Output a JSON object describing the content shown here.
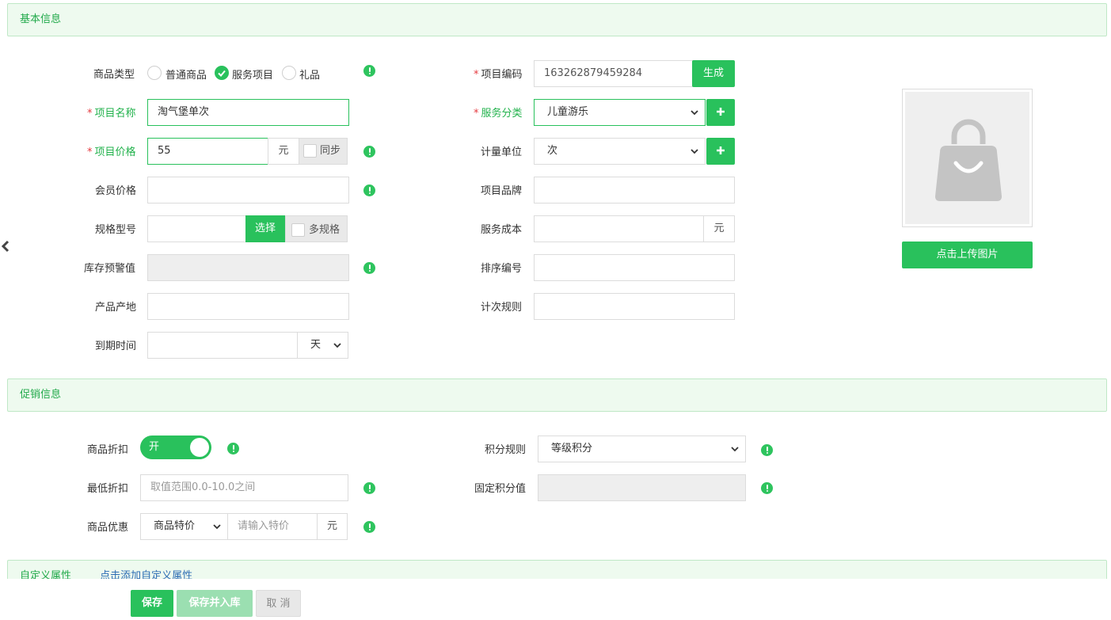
{
  "sections": {
    "basic": "基本信息",
    "promo": "促销信息",
    "custom": "自定义属性",
    "custom_add": "点击添加自定义属性"
  },
  "basic": {
    "product_type": {
      "label": "商品类型",
      "options": [
        "普通商品",
        "服务项目",
        "礼品"
      ],
      "selected": "服务项目"
    },
    "item_name": {
      "label": "项目名称",
      "value": "淘气堡单次"
    },
    "item_price": {
      "label": "项目价格",
      "value": "55",
      "unit": "元",
      "sync": "同步"
    },
    "member_price": {
      "label": "会员价格",
      "value": ""
    },
    "spec": {
      "label": "规格型号",
      "value": "",
      "choose": "选择",
      "multi": "多规格"
    },
    "stock_alert": {
      "label": "库存预警值",
      "value": ""
    },
    "origin": {
      "label": "产品产地",
      "value": ""
    },
    "expire": {
      "label": "到期时间",
      "value": "",
      "unit": "天"
    },
    "item_code": {
      "label": "项目编码",
      "value": "163262879459284",
      "generate": "生成"
    },
    "service_category": {
      "label": "服务分类",
      "value": "儿童游乐"
    },
    "measure_unit": {
      "label": "计量单位",
      "value": "次"
    },
    "brand": {
      "label": "项目品牌",
      "value": ""
    },
    "service_cost": {
      "label": "服务成本",
      "value": "",
      "unit": "元"
    },
    "sort_no": {
      "label": "排序编号",
      "value": ""
    },
    "count_rule": {
      "label": "计次规则",
      "value": ""
    },
    "upload": "点击上传图片"
  },
  "promo": {
    "discount": {
      "label": "商品折扣",
      "toggle": "开"
    },
    "min_discount": {
      "label": "最低折扣",
      "placeholder": "取值范围0.0-10.0之间"
    },
    "offer": {
      "label": "商品优惠",
      "type": "商品特价",
      "placeholder": "请输入特价",
      "unit": "元"
    },
    "points_rule": {
      "label": "积分规则",
      "value": "等级积分"
    },
    "fixed_points": {
      "label": "固定积分值",
      "value": ""
    }
  },
  "actions": {
    "save": "保存",
    "save_stock": "保存并入库",
    "cancel": "取 消"
  },
  "colors": {
    "accent": "#29c15c",
    "section_bg": "#eefaef",
    "required": "#e5393f"
  }
}
